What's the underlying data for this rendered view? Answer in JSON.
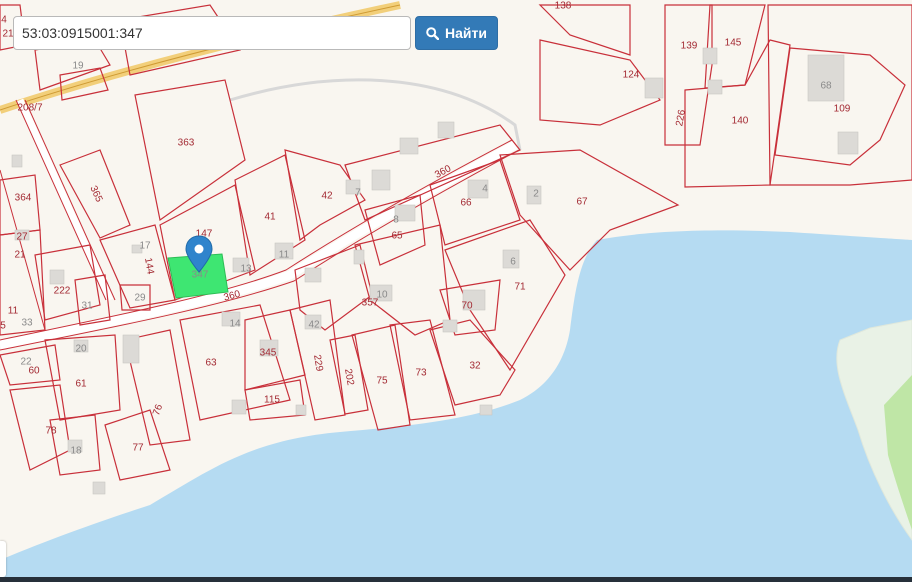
{
  "search": {
    "value": "53:03:0915001:347",
    "button_label": "Найти"
  },
  "icons": {
    "search": "search-icon",
    "marker": "map-marker-icon"
  },
  "colors": {
    "water": "#b5dbf2",
    "selected_parcel": "#3ee672",
    "parcel_border": "#c8303a",
    "land": "#f9f6f0",
    "button": "#337ab7"
  },
  "map_labels": {
    "l4": "4",
    "l21a": "21",
    "l19": "19",
    "l208": "208/7",
    "l138": "138",
    "l139": "139",
    "l145": "145",
    "l124": "124",
    "l68": "68",
    "l109": "109",
    "l226": "226",
    "l140": "140",
    "l363": "363",
    "l365": "365",
    "l364": "364",
    "l27": "27",
    "l21b": "21",
    "l147": "147",
    "l41": "41",
    "l42a": "42",
    "l7": "7",
    "l360a": "360",
    "l4b": "4",
    "l66": "66",
    "l2": "2",
    "l67": "67",
    "l8": "8",
    "l65": "65",
    "l17": "17",
    "l144": "144",
    "l347": "347",
    "l11a": "11",
    "l13": "13",
    "l222": "222",
    "l31": "31",
    "l29": "29",
    "l360b": "360",
    "l6": "6",
    "l71": "71",
    "l11b": "11",
    "l33": "33",
    "l5": "5",
    "l10": "10",
    "l357": "357",
    "l70": "70",
    "l14": "14",
    "l42b": "42",
    "l22": "22",
    "l20": "20",
    "l60": "60",
    "l345": "345",
    "l63": "63",
    "l229": "229",
    "l202": "202",
    "l75": "75",
    "l73": "73",
    "l32": "32",
    "l61": "61",
    "l76": "76",
    "l115": "115",
    "l78": "78",
    "l18": "18",
    "l77": "77"
  }
}
